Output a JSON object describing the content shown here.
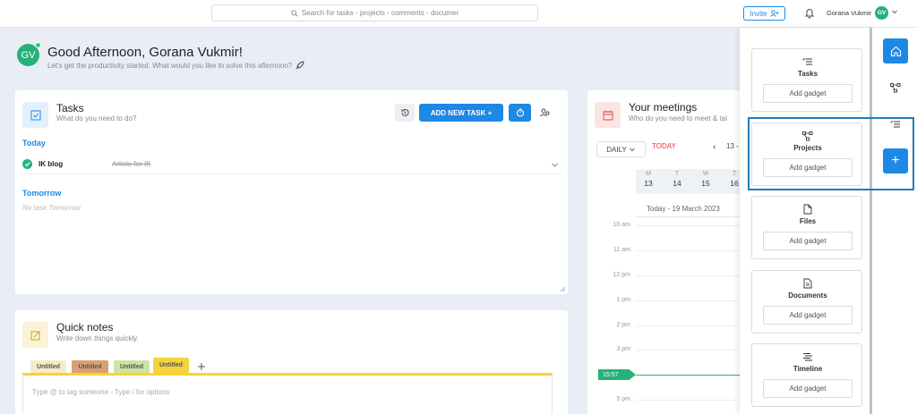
{
  "topbar": {
    "search_placeholder": "Search for tasks - projects - comments - documer",
    "invite_label": "Invite",
    "user_name": "Gorana Vukmir",
    "user_initials": "GV"
  },
  "greeting": {
    "initials": "GV",
    "title": "Good Afternoon, Gorana Vukmir!",
    "subtitle": "Let's get the productivity started. What would you like to solve this afternoon?"
  },
  "tasks": {
    "title": "Tasks",
    "subtitle": "What do you need to do?",
    "add_button": "ADD NEW TASK +",
    "today_label": "Today",
    "items": [
      {
        "name": "IK blog",
        "project": "Article for IK"
      }
    ],
    "tomorrow_label": "Tomorrow",
    "tomorrow_empty": "No task Tomorrow"
  },
  "notes": {
    "title": "Quick notes",
    "subtitle": "Write down things quickly.",
    "tabs": [
      {
        "label": "Untitled",
        "color": "#f7ecc4"
      },
      {
        "label": "Untitled",
        "color": "#d9a072"
      },
      {
        "label": "Untitled",
        "color": "#cfe3a3"
      },
      {
        "label": "Untitled",
        "color": "#f5d33c"
      }
    ],
    "add_label": "+",
    "placeholder": "Type @ to tag someone - Type / for options"
  },
  "meetings": {
    "title": "Your meetings",
    "subtitle": "Who do you need to meet & tal",
    "view": "DAILY",
    "today_link": "TODAY",
    "prev": "‹",
    "range": "13 -",
    "days": [
      {
        "d": "M",
        "n": "13"
      },
      {
        "d": "T",
        "n": "14"
      },
      {
        "d": "W",
        "n": "15"
      },
      {
        "d": "T",
        "n": "16"
      }
    ],
    "today_date": "Today - 19 March 2023",
    "hours": [
      "10 am",
      "11 am",
      "12 pm",
      "1 pm",
      "2 pm",
      "3 pm",
      "4 pm",
      "5 pm"
    ],
    "now": "15:57"
  },
  "gadgets": [
    {
      "name": "Tasks",
      "icon": "tasks-icon",
      "button": "Add gadget"
    },
    {
      "name": "Projects",
      "icon": "projects-icon",
      "button": "Add gadget"
    },
    {
      "name": "Files",
      "icon": "files-icon",
      "button": "Add gadget"
    },
    {
      "name": "Documents",
      "icon": "documents-icon",
      "button": "Add gadget"
    },
    {
      "name": "Timeline",
      "icon": "timeline-icon",
      "button": "Add gadget"
    }
  ],
  "rail": {
    "plus": "+"
  },
  "colors": {
    "accent": "#1e88e5",
    "green": "#27b07a",
    "highlight": "#1e7fb8"
  }
}
